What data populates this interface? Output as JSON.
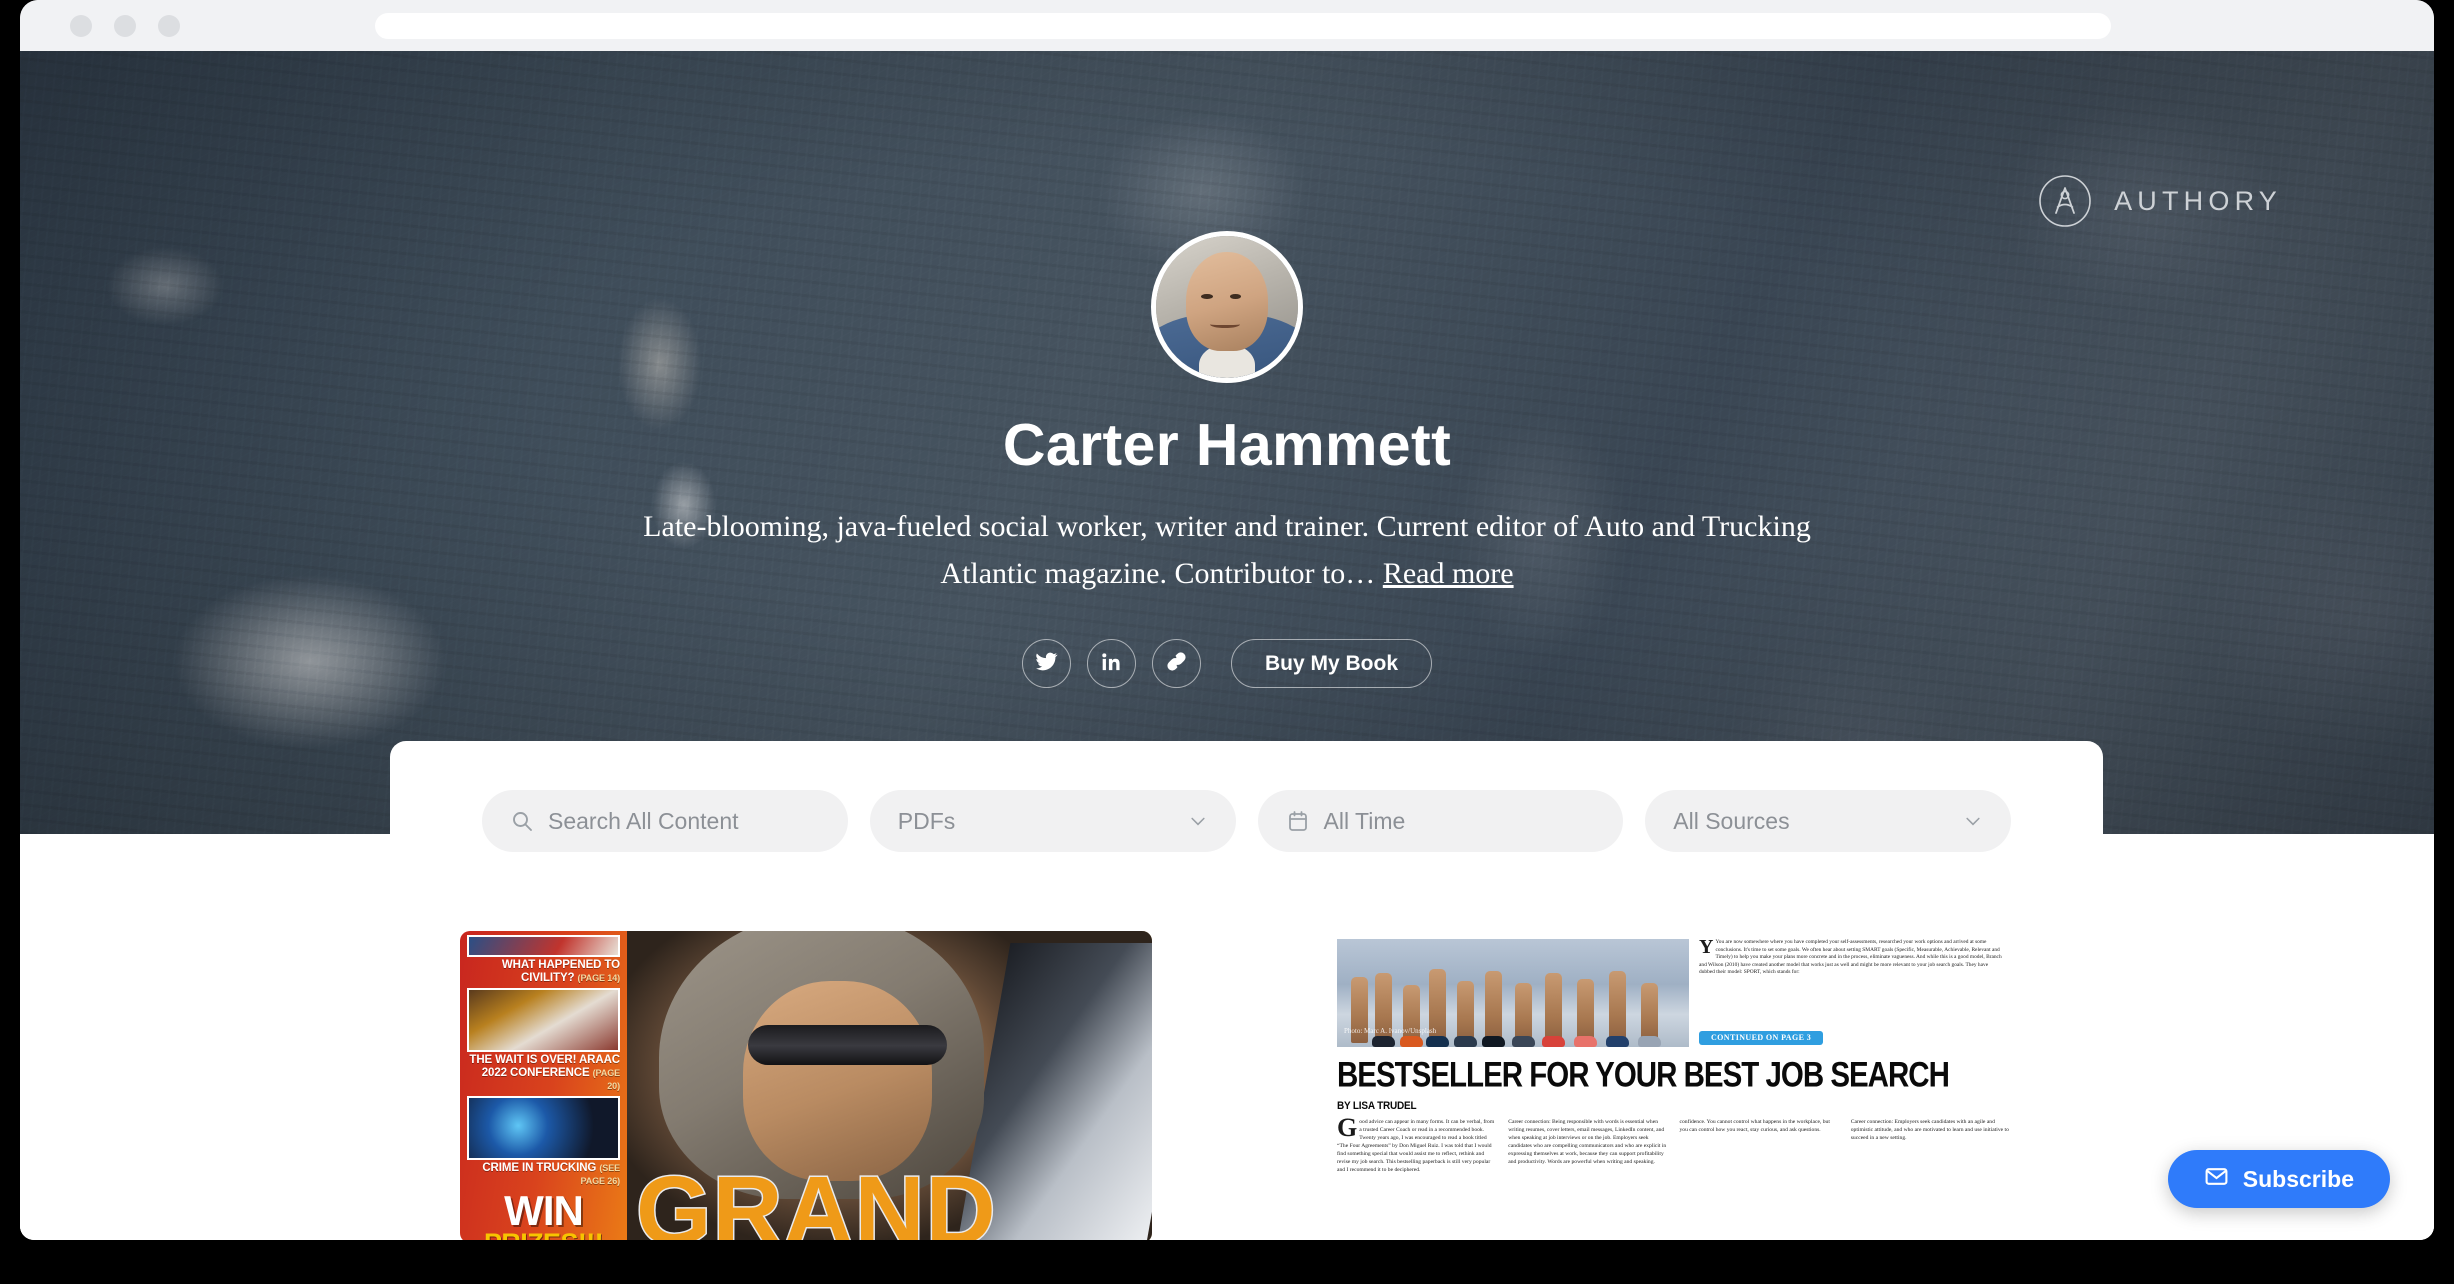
{
  "browser": {
    "url_value": "",
    "url_placeholder": ""
  },
  "hero": {
    "brand_name": "AUTHORY",
    "profile_name": "Carter Hammett",
    "bio_text": "Late-blooming, java-fueled social worker, writer and trainer. Current editor of Auto and Trucking Atlantic magazine. Contributor to… ",
    "read_more_label": "Read more",
    "buy_book_label": "Buy My Book",
    "socials": [
      {
        "name": "twitter",
        "label": "Twitter"
      },
      {
        "name": "linkedin",
        "label": "LinkedIn"
      },
      {
        "name": "website-link",
        "label": "Website"
      }
    ]
  },
  "filters": {
    "search_placeholder": "Search All Content",
    "search_value": "",
    "type_value": "PDFs",
    "time_value": "All Time",
    "sources_value": "All Sources"
  },
  "cards": {
    "magazine": {
      "captions": [
        {
          "text": "WHAT HAPPENED TO CIVILITY?",
          "page": "(PAGE 14)"
        },
        {
          "text": "THE WAIT IS OVER! ARAAC 2022 CONFERENCE",
          "page": "(PAGE 20)"
        },
        {
          "text": "CRIME IN TRUCKING",
          "page": "(SEE PAGE 26)"
        }
      ],
      "win_label": "WIN",
      "prizes_label": "PRIZES!!!",
      "grand_label": "GRAND"
    },
    "news": {
      "headline": "BESTSELLER FOR YOUR BEST JOB SEARCH",
      "byline": "BY LISA TRUDEL",
      "photo_credit": "Photo: Marc A. Ivanov/Unsplash",
      "continued_label": "CONTINUED ON PAGE 3",
      "side_text": "You are now somewhere where you have completed your self-assessments, researched your work options and arrived at some conclusions. It's time to set some goals. We often hear about setting SMART goals (Specific, Measurable, Achievable, Relevant and Timely) to help you make your plans more concrete and in the process, eliminate vagueness. And while this is a good model, Branch and Wilson (2010) have created another model that works just as well and might be more relevant to your job search goals. They have dubbed their model: SPORT, which stands for:",
      "columns": [
        "ood advice can appear in many forms. It can be verbal, from a trusted Career Coach or read in a recommended book. Twenty years ago, I was encouraged to read a book titled “The Four Agreements” by Don Miguel Ruiz. I was told that I would find something special that would assist me to reflect, rethink and revise my job search. This bestselling paperback is still very popular and I recommend it to be deciphered.",
        "Career connection: Being responsible with words is essential when writing resumes, cover letters, email messages, LinkedIn content, and when speaking at job interviews or on the job. Employers seek candidates who are compelling communicators and who are explicit in expressing themselves at work, because they can support profitability and productivity. Words are powerful when writing and speaking.",
        "confidence. You cannot control what happens in the workplace, but you can control how you react, stay curious, and ask questions.",
        "Career connection: Employers seek candidates with an agile and optimistic attitude, and who are motivated to learn and use initiative to succeed in a new setting."
      ]
    }
  },
  "subscribe": {
    "label": "Subscribe"
  }
}
